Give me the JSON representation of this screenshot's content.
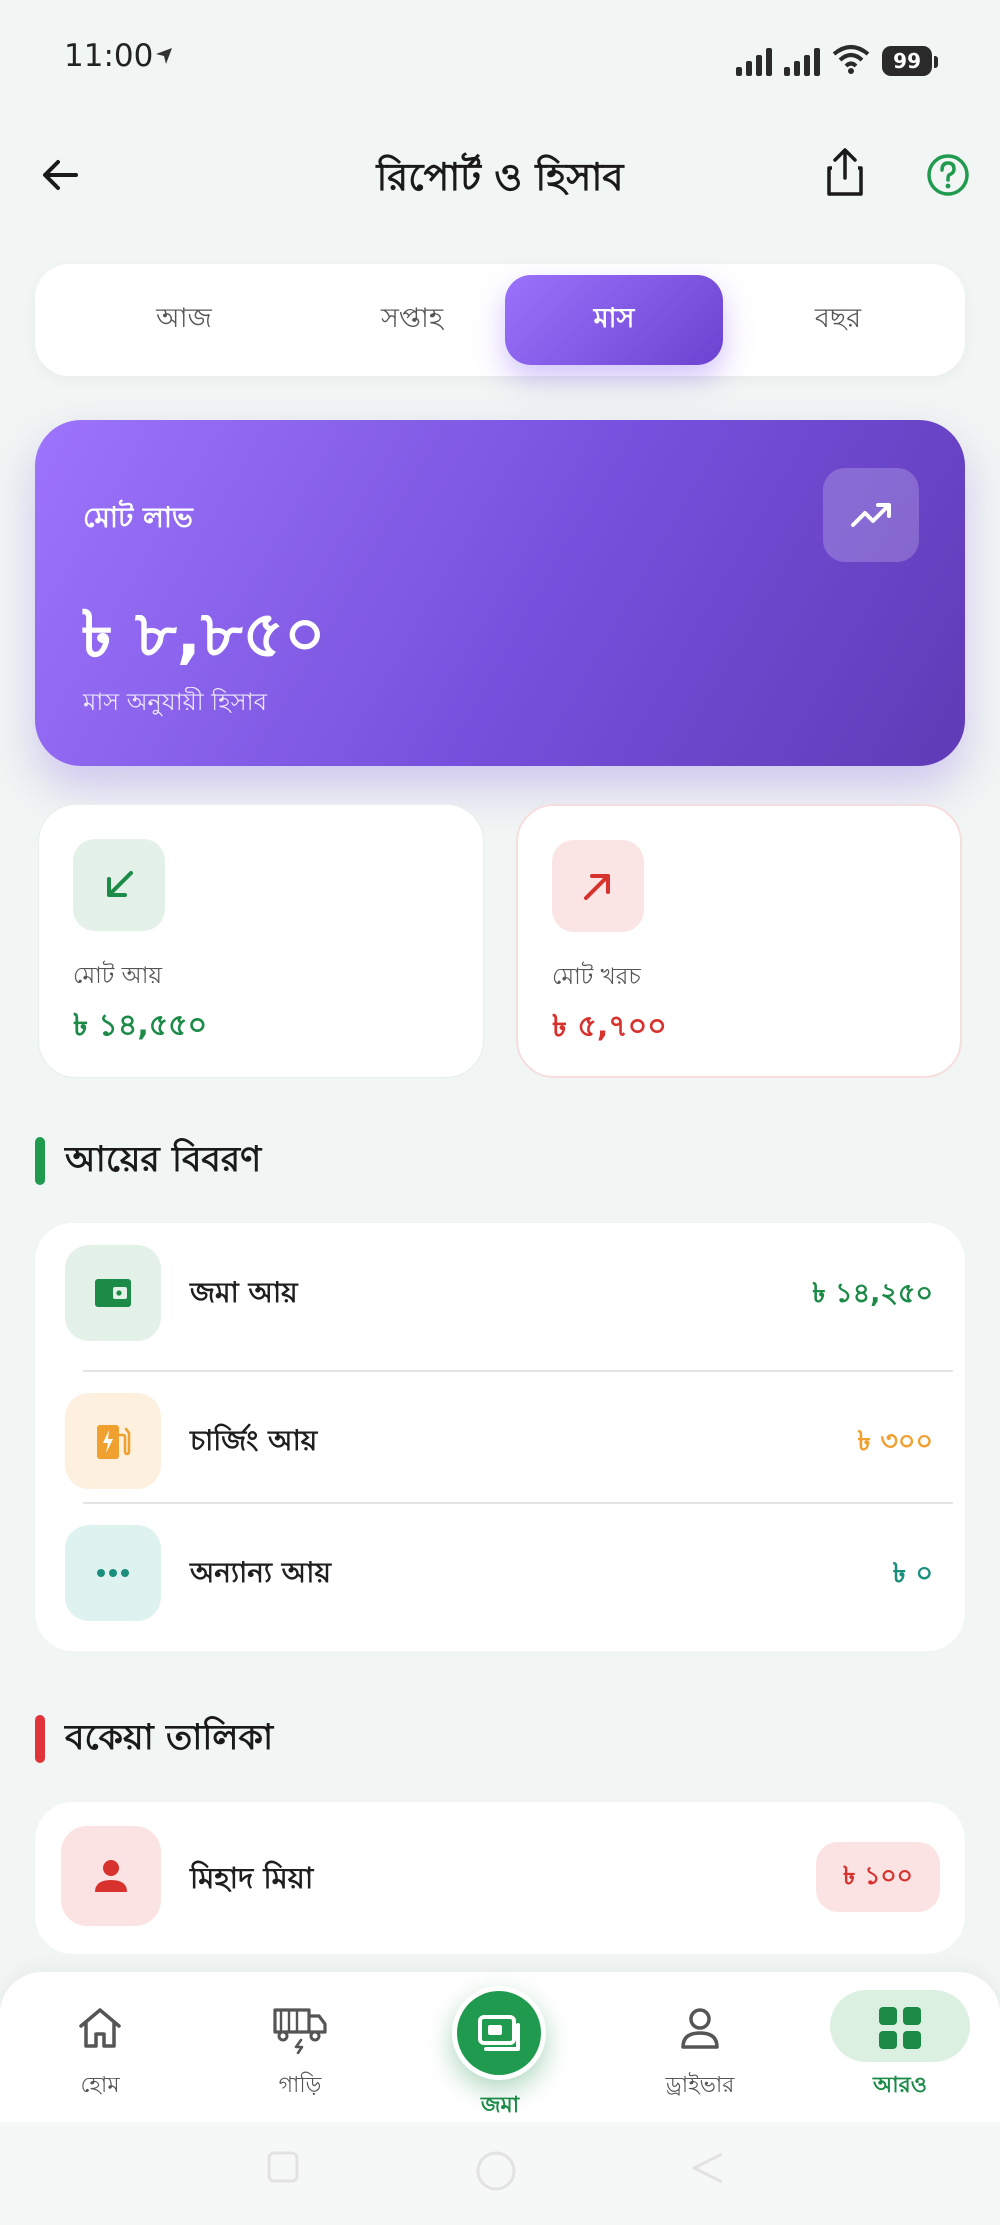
{
  "status_bar": {
    "time": "11:00",
    "battery": "99",
    "icons": [
      "navigation-arrow-icon",
      "signal-icon",
      "signal-icon",
      "wifi-icon",
      "battery-icon"
    ]
  },
  "header": {
    "title": "রিপোর্ট ও হিসাব",
    "back_icon": "arrow-left-icon",
    "share_icon": "share-icon",
    "help_icon": "help-circle-icon"
  },
  "period_tabs": [
    {
      "label": "আজ",
      "active": false
    },
    {
      "label": "সপ্তাহ",
      "active": false
    },
    {
      "label": "মাস",
      "active": true
    },
    {
      "label": "বছর",
      "active": false
    }
  ],
  "profit_card": {
    "label": "মোট লাভ",
    "value": "৳ ৮,৮৫০",
    "subtitle": "মাস অনুযায়ী হিসাব",
    "icon": "trending-up-icon"
  },
  "summary": {
    "income": {
      "label": "মোট আয়",
      "value": "৳ ১৪,৫৫০",
      "icon": "arrow-down-left-icon",
      "color": "#1c8b48"
    },
    "expense": {
      "label": "মোট খরচ",
      "value": "৳ ৫,৭০০",
      "icon": "arrow-up-right-icon",
      "color": "#d8322e"
    }
  },
  "income_details": {
    "title": "আয়ের বিবরণ",
    "accent": "#1f9a4e",
    "items": [
      {
        "label": "জমা আয়",
        "value": "৳ ১৪,২৫০",
        "icon": "wallet-icon",
        "color": "#1c8b48"
      },
      {
        "label": "চার্জিং আয়",
        "value": "৳ ৩০০",
        "icon": "charging-icon",
        "color": "#f0a02e"
      },
      {
        "label": "অন্যান্য আয়",
        "value": "৳ ০",
        "icon": "more-dots-icon",
        "color": "#1a8f7e"
      }
    ]
  },
  "due_list": {
    "title": "বকেয়া তালিকা",
    "accent": "#e0343a",
    "items": [
      {
        "name": "মিহাদ মিয়া",
        "amount": "৳ ১০০",
        "icon": "person-icon"
      }
    ]
  },
  "bottom_nav": {
    "items": [
      {
        "label": "হোম",
        "icon": "home-icon",
        "active": false
      },
      {
        "label": "গাড়ি",
        "icon": "vehicle-icon",
        "active": false
      },
      {
        "label": "জমা",
        "icon": "deposit-icon",
        "active": false
      },
      {
        "label": "ড্রাইভার",
        "icon": "driver-icon",
        "active": false
      },
      {
        "label": "আরও",
        "icon": "grid-icon",
        "active": true
      }
    ]
  }
}
